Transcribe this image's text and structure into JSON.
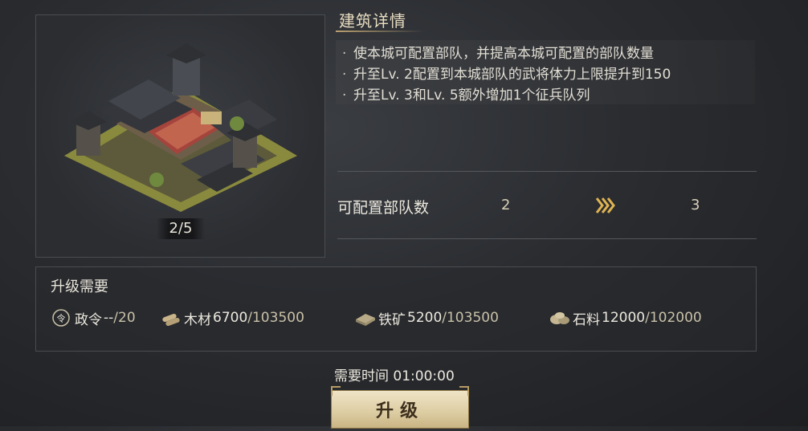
{
  "building": {
    "level_progress": "2/5"
  },
  "detail": {
    "title": "建筑详情",
    "lines": [
      "使本城可配置部队，并提高本城可配置的部队数量",
      "升至Lv. 2配置到本城部队的武将体力上限提升到150",
      "升至Lv. 3和Lv. 5额外增加1个征兵队列"
    ],
    "bullet": "·"
  },
  "stat": {
    "label": "可配置部队数",
    "from": "2",
    "to": "3",
    "arrow_icon": "double-chevron-right-icon"
  },
  "requirements": {
    "title": "升级需要",
    "items": [
      {
        "icon": "decree-icon",
        "name": "政令",
        "current": "--",
        "total": "/20"
      },
      {
        "icon": "wood-icon",
        "name": "木材",
        "current": "6700",
        "total": "/103500"
      },
      {
        "icon": "iron-icon",
        "name": "铁矿",
        "current": "5200",
        "total": "/103500"
      },
      {
        "icon": "stone-icon",
        "name": "石料",
        "current": "12000",
        "total": "/102000"
      }
    ]
  },
  "time": {
    "label": "需要时间",
    "value": "01:00:00"
  },
  "upgrade_button": "升级",
  "colors": {
    "accent_gold": "#d9b45a",
    "button_bg": "#e3d4ad"
  }
}
